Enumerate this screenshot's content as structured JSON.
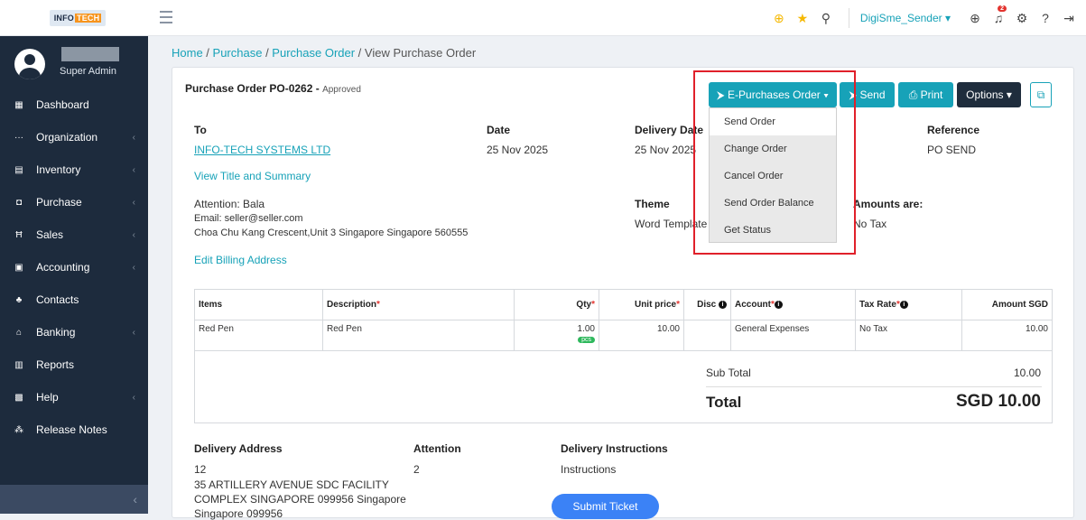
{
  "header": {
    "logo_a": "INFO",
    "logo_b": "TECH",
    "user": "DigiSme_Sender ▾",
    "notif_count": "2"
  },
  "sidebar": {
    "role": "Super Admin",
    "items": [
      {
        "label": "Dashboard",
        "icon": "dashboard-icon",
        "sub": false
      },
      {
        "label": "Organization",
        "icon": "ellipsis-icon",
        "sub": true
      },
      {
        "label": "Inventory",
        "icon": "inventory-icon",
        "sub": true
      },
      {
        "label": "Purchase",
        "icon": "bag-icon",
        "sub": true
      },
      {
        "label": "Sales",
        "icon": "cart-icon",
        "sub": true
      },
      {
        "label": "Accounting",
        "icon": "accounting-icon",
        "sub": true
      },
      {
        "label": "Contacts",
        "icon": "contacts-icon",
        "sub": false
      },
      {
        "label": "Banking",
        "icon": "bank-icon",
        "sub": true
      },
      {
        "label": "Reports",
        "icon": "reports-icon",
        "sub": false
      },
      {
        "label": "Help",
        "icon": "help-icon",
        "sub": true
      },
      {
        "label": "Release Notes",
        "icon": "notes-icon",
        "sub": false
      }
    ]
  },
  "breadcrumb": {
    "home": "Home",
    "purchase": "Purchase",
    "po": "Purchase Order",
    "current": "View Purchase Order"
  },
  "po": {
    "title": "Purchase Order PO-0262 - ",
    "status": "Approved",
    "to_label": "To",
    "to_value": "INFO-TECH SYSTEMS LTD",
    "date_label": "Date",
    "date_value": "25 Nov 2025",
    "delivery_label": "Delivery Date",
    "delivery_value": "25 Nov 2025",
    "ref_label": "Reference",
    "ref_value": "PO SEND",
    "view_title": "View Title and Summary",
    "attention": "Attention: Bala",
    "email": "Email: seller@seller.com",
    "address": "Choa Chu Kang Crescent,Unit 3 Singapore Singapore 560555",
    "theme_label": "Theme",
    "theme_value": "Word Template",
    "amounts_label": "Amounts are:",
    "amounts_value": "No Tax",
    "edit_billing": "Edit Billing Address"
  },
  "buttons": {
    "epo": "⮞ E-Purchases Order ▾",
    "send": "⮞ Send",
    "print": "⎙ Print",
    "options": "Options ▾"
  },
  "dropdown": [
    "Send Order",
    "Change Order",
    "Cancel Order",
    "Send Order Balance",
    "Get Status"
  ],
  "table": {
    "headers": {
      "items": "Items",
      "description": "Description",
      "qty": "Qty",
      "unit": "Unit price",
      "disc": "Disc",
      "account": "Account",
      "tax": "Tax Rate",
      "amount": "Amount SGD"
    },
    "row": {
      "item": "Red Pen",
      "description": "Red Pen",
      "qty": "1.00",
      "unit_tag": "pcs",
      "unit_price": "10.00",
      "account": "General Expenses",
      "tax": "No Tax",
      "amount": "10.00"
    }
  },
  "totals": {
    "sub_label": "Sub Total",
    "sub_value": "10.00",
    "total_label": "Total",
    "total_value": "SGD 10.00"
  },
  "delivery": {
    "addr_label": "Delivery Address",
    "attn_label": "Attention",
    "instr_label": "Delivery Instructions",
    "line1": "12",
    "line2": "35 ARTILLERY AVENUE SDC FACILITY",
    "line3": "COMPLEX SINGAPORE 099956 Singapore",
    "line4": "Singapore 099956",
    "attn_value": "2",
    "instr_value": "Instructions"
  },
  "ticket": "Submit Ticket"
}
